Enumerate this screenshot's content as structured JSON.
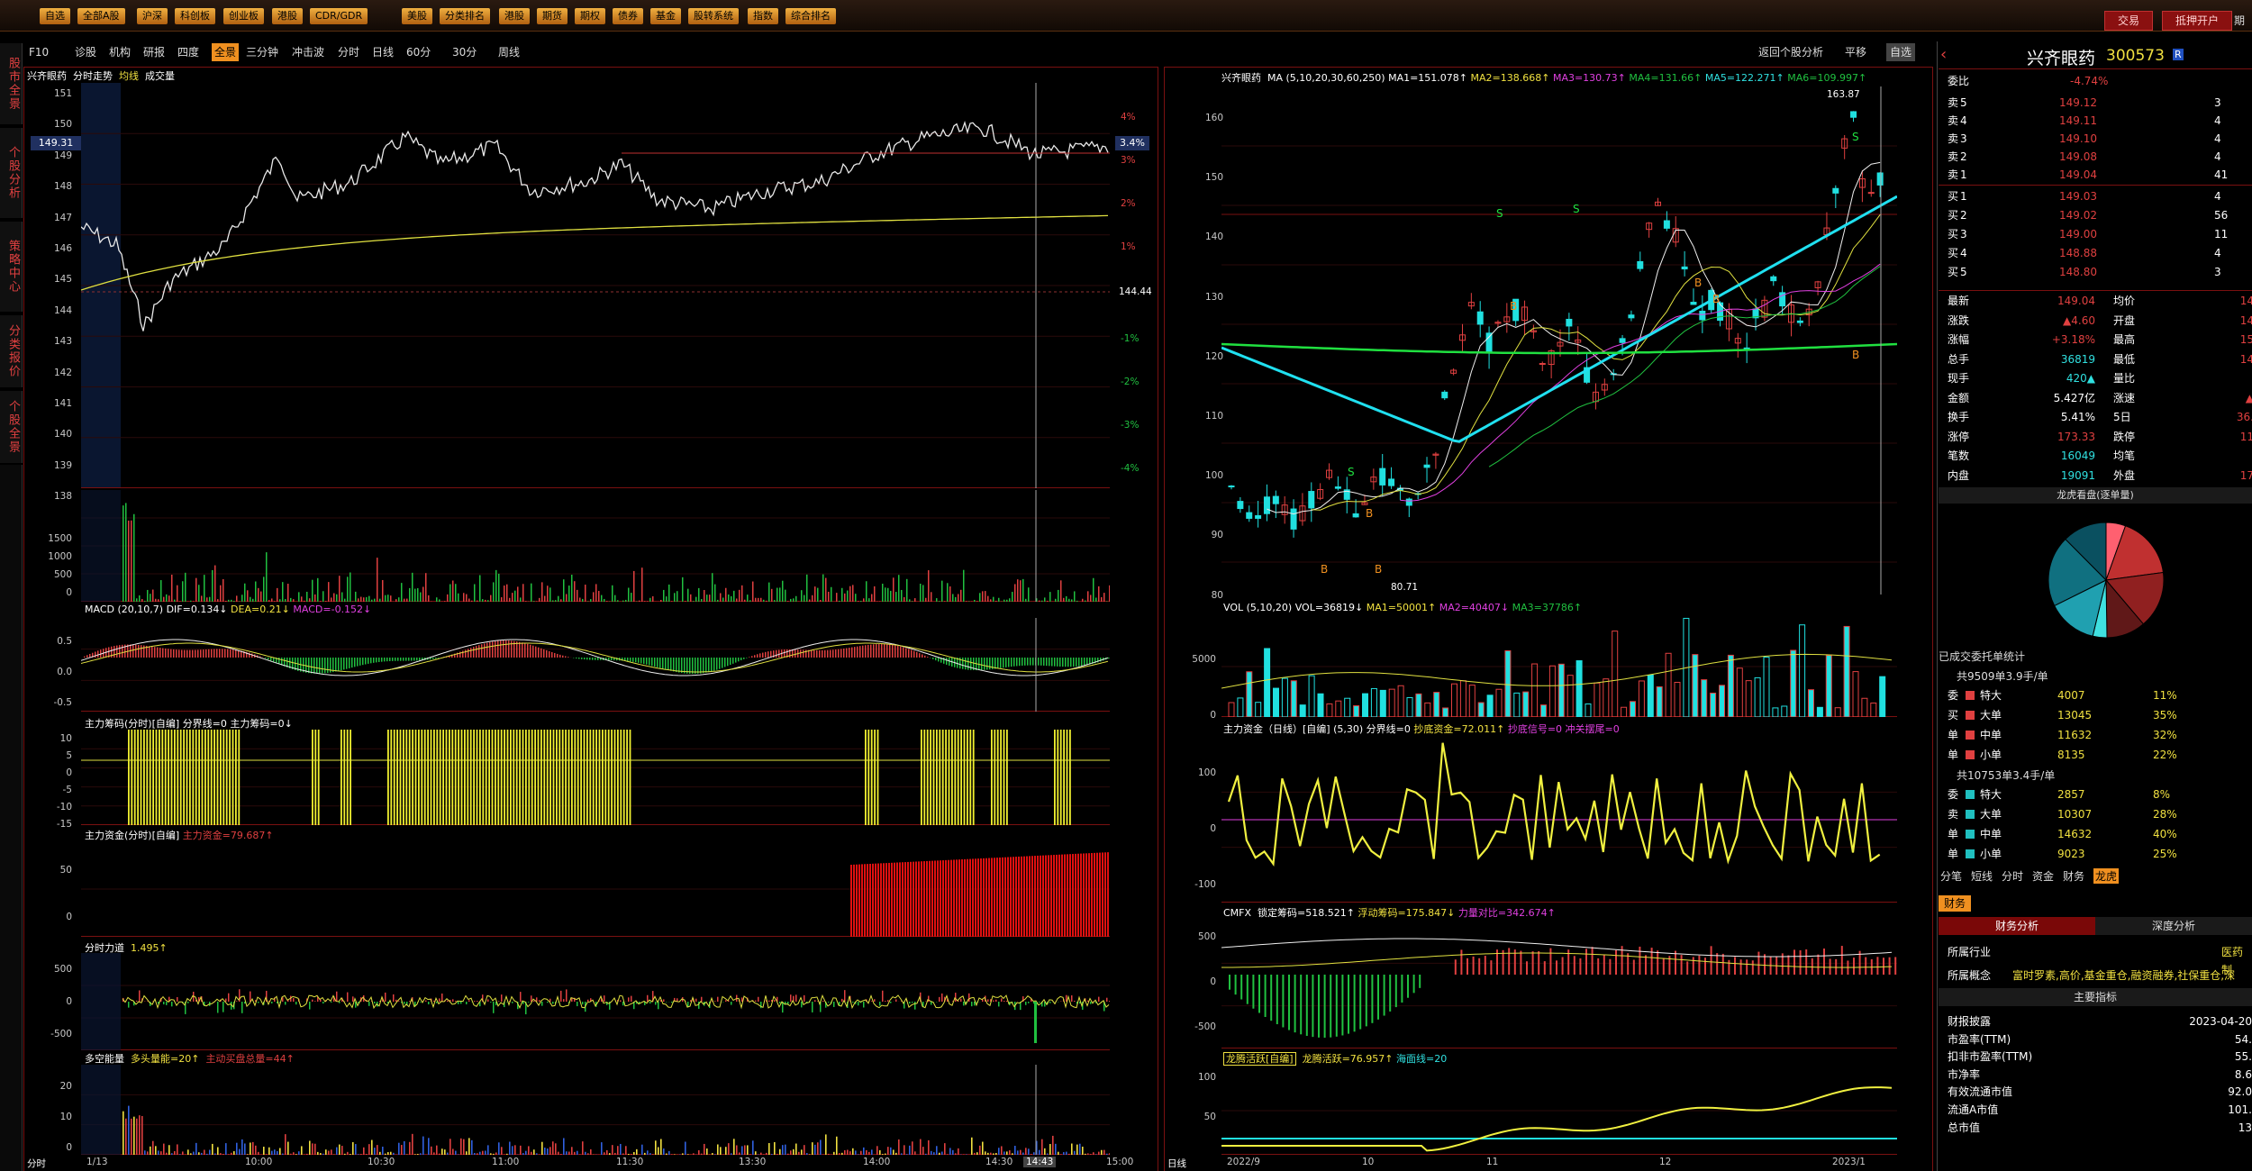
{
  "top": {
    "logo": "",
    "menus": [
      "自选",
      "全部A股",
      "沪深",
      "科创板",
      "创业板",
      "港股",
      "CDR/GDR",
      "美股",
      "分类排名",
      "港股",
      "期货",
      "期权",
      "债券",
      "基金",
      "股转系统",
      "指数",
      "综合排名"
    ],
    "trade": "交易",
    "margin": "抵押开户",
    "more": "期"
  },
  "sidetabs": [
    "股市全景",
    "个股分析",
    "策略中心",
    "分类报价",
    "个股全景"
  ],
  "subbar": {
    "items": [
      "F10",
      "诊股",
      "机构",
      "研报",
      "四度",
      "全景",
      "三分钟",
      "冲击波",
      "分时",
      "日线",
      "60分",
      "30分",
      "周线"
    ],
    "right": [
      "返回个股分析",
      "平移",
      "自选"
    ]
  },
  "left": {
    "title": "兴齐眼药",
    "title2": "分时走势",
    "avg": "均线",
    "vol": "成交量",
    "yaxis": [
      "151",
      "150",
      "149",
      "148",
      "147",
      "146",
      "145",
      "144",
      "143",
      "142",
      "141",
      "140",
      "139",
      "138"
    ],
    "pct": [
      "4%",
      "3%",
      "2%",
      "1%",
      "-1%",
      "-2%",
      "-3%",
      "-4%"
    ],
    "price_tag": "149.31",
    "pct_tag": "3.4%",
    "pre_close": "144.44",
    "vol_axis": [
      "1500",
      "1000",
      "500",
      "0"
    ],
    "macd": {
      "label": "MACD",
      "params": "(20,10,7)",
      "dif": "DIF=0.134↓",
      "dea": "DEA=0.21↓",
      "macd": "MACD=-0.152↓",
      "axis": [
        "0.5",
        "0.0",
        "-0.5"
      ]
    },
    "zljm": {
      "label": "主力筹码(分时)",
      "tag": "[自编]",
      "f1": "分界线=0",
      "f2": "主力筹码=0↓",
      "axis": [
        "10",
        "5",
        "0",
        "-5",
        "-10",
        "-15"
      ]
    },
    "zlzj": {
      "label": "主力资金(分时)",
      "tag": "[自编]",
      "f1": "主力资金=79.687↑",
      "axis": [
        "50",
        "0"
      ]
    },
    "fsld": {
      "label": "分时力道",
      "f1": "1.495↑",
      "axis": [
        "500",
        "0",
        "-500"
      ]
    },
    "dknl": {
      "label": "多空能量",
      "f1": "多头量能=20↑",
      "f2": "主动买盘总量=44↑",
      "axis": [
        "20",
        "10",
        "0"
      ]
    },
    "xaxis": [
      "1/13",
      "10:00",
      "10:30",
      "11:00",
      "11:30",
      "13:30",
      "14:00",
      "14:30",
      "14:43",
      "15:00"
    ],
    "xleft": "分时"
  },
  "mid": {
    "title": "兴齐眼药",
    "ma": "MA",
    "params": "(5,10,20,30,60,250)",
    "ma1": "MA1=151.078↑",
    "ma2": "MA2=138.668↑",
    "ma3": "MA3=130.73↑",
    "ma4": "MA4=131.66↑",
    "ma5": "MA5=122.271↑",
    "ma6": "MA6=109.997↑",
    "yaxis": [
      "160",
      "150",
      "140",
      "130",
      "120",
      "110",
      "100",
      "90",
      "80"
    ],
    "high": "163.87",
    "low": "80.71",
    "vol": {
      "label": "VOL",
      "params": "(5,10,20)",
      "v": "VOL=36819↓",
      "ma1": "MA1=50001↑",
      "ma2": "MA2=40407↓",
      "ma3": "MA3=37786↑",
      "axis": [
        "5000",
        "0"
      ]
    },
    "zlzj": {
      "label": "主力资金（日线）",
      "tag": "[自编]",
      "params": "(5,30)",
      "f1": "分界线=0",
      "f2": "抄底资金=72.011↑",
      "f3": "抄底信号=0",
      "f4": "冲关摆尾=0",
      "axis": [
        "100",
        "0",
        "-100"
      ]
    },
    "cmfx": {
      "label": "CMFX",
      "f1": "锁定筹码=518.521↑",
      "f2": "浮动筹码=175.847↓",
      "f3": "力量对比=342.674↑",
      "axis": [
        "500",
        "0",
        "-500"
      ]
    },
    "lthy": {
      "label": "龙腾活跃[自编]",
      "f1": "龙腾活跃=76.957↑",
      "f2": "海面线=20",
      "axis": [
        "100",
        "50"
      ]
    },
    "xaxis": [
      "2022/9",
      "10",
      "11",
      "12",
      "2023/1"
    ],
    "xleft": "日线"
  },
  "right": {
    "name": "兴齐眼药",
    "code": "300573",
    "tag": "R",
    "weibi": "委比",
    "weibi_v": "-4.74%",
    "asks": [
      [
        "5",
        "149.12",
        "3"
      ],
      [
        "4",
        "149.11",
        "4"
      ],
      [
        "3",
        "149.10",
        "4"
      ],
      [
        "2",
        "149.08",
        "4"
      ],
      [
        "1",
        "149.04",
        "41"
      ]
    ],
    "bids": [
      [
        "1",
        "149.03",
        "4"
      ],
      [
        "2",
        "149.02",
        "56"
      ],
      [
        "3",
        "149.00",
        "11"
      ],
      [
        "4",
        "148.88",
        "4"
      ],
      [
        "5",
        "148.80",
        "3"
      ]
    ],
    "stats": [
      [
        "最新",
        "149.04",
        "均价",
        "14"
      ],
      [
        "涨跌",
        "▲4.60",
        "开盘",
        "14"
      ],
      [
        "涨幅",
        "+3.18%",
        "最高",
        "15"
      ],
      [
        "总手",
        "36819",
        "最低",
        "14"
      ],
      [
        "现手",
        "420▲",
        "量比",
        ""
      ],
      [
        "金额",
        "5.427亿",
        "涨速",
        "▲"
      ],
      [
        "换手",
        "5.41%",
        "5日",
        "36."
      ],
      [
        "涨停",
        "173.33",
        "跌停",
        "11"
      ],
      [
        "笔数",
        "16049",
        "均笔",
        ""
      ],
      [
        "内盘",
        "19091",
        "外盘",
        "17"
      ]
    ],
    "lh_title": "龙虎看盘(逐单量)",
    "done_title": "已成交委托单统计",
    "buy_head": "共9509单3.9手/单",
    "buy": [
      [
        "特大",
        "4007",
        "11%"
      ],
      [
        "大单",
        "13045",
        "35%"
      ],
      [
        "中单",
        "11632",
        "32%"
      ],
      [
        "小单",
        "8135",
        "22%"
      ]
    ],
    "sell_head": "共10753单3.4手/单",
    "sell": [
      [
        "特大",
        "2857",
        "8%"
      ],
      [
        "大单",
        "10307",
        "28%"
      ],
      [
        "中单",
        "14632",
        "40%"
      ],
      [
        "小单",
        "9023",
        "25%"
      ]
    ],
    "side_buy": [
      "委",
      "买",
      "单"
    ],
    "side_sell": [
      "委",
      "卖",
      "单"
    ],
    "tabs": [
      "分笔",
      "短线",
      "分时",
      "资金",
      "财务",
      "龙虎"
    ],
    "fin_tab": "财务",
    "fin_a": "财务分析",
    "fin_b": "深度分析",
    "industry_l": "所属行业",
    "industry_v": "医药制",
    "concept_l": "所属概念",
    "concept_v": "富时罗素,高价,基金重仓,融资融券,社保重仓,深",
    "main_idx": "主要指标",
    "fin": [
      [
        "财报披露",
        "2023-04-20"
      ],
      [
        "市盈率(TTM)",
        "54."
      ],
      [
        "扣非市盈率(TTM)",
        "55."
      ],
      [
        "市净率",
        "8.6"
      ],
      [
        "有效流通市值",
        "92.0"
      ],
      [
        "流通A市值",
        "101."
      ],
      [
        "总市值",
        "13"
      ]
    ]
  }
}
